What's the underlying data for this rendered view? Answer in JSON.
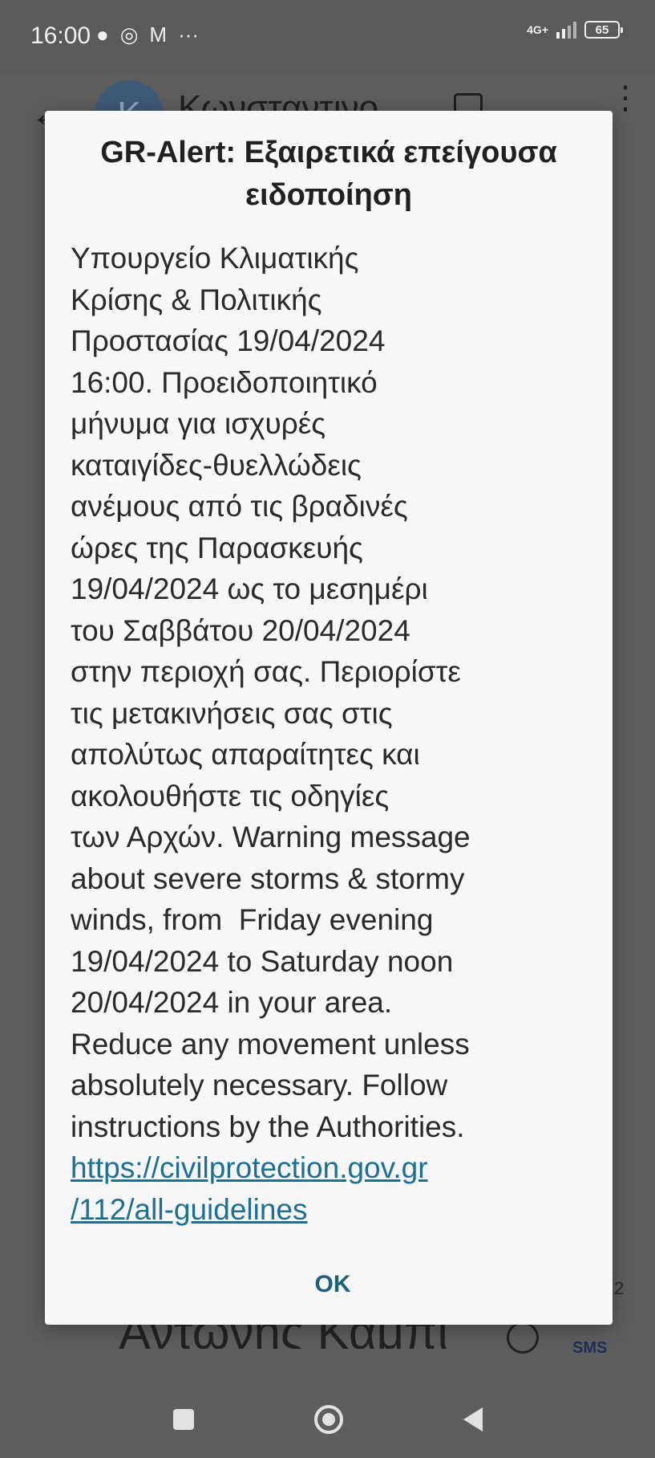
{
  "status_bar": {
    "time": "16:00",
    "notif_icons": [
      "chat-bubble-icon",
      "whatsapp-icon",
      "gmail-icon",
      "more-notifications-icon"
    ],
    "network": "4G+",
    "battery": "65"
  },
  "background": {
    "contact_avatar_letter": "K",
    "contact_name": "Κωνσταντινο",
    "composer_text": "Αντώνης Καμπι",
    "sms_label": "SMS",
    "message_count": "2"
  },
  "dialog": {
    "title": "GR-Alert: Εξαιρετικά επείγουσα ειδοποίηση",
    "body_lines": [
      "Υπουργείο Κλιματικής",
      "Κρίσης & Πολιτικής",
      "Προστασίας 19/04/2024",
      "16:00. Προειδοποιητικό",
      "μήνυμα για ισχυρές",
      "καταιγίδες-θυελλώδεις",
      "ανέμους από τις βραδινές",
      "ώρες της Παρασκευής",
      "19/04/2024 ως το μεσημέρι",
      "του Σαββάτου 20/04/2024",
      "στην περιοχή σας. Περιορίστε",
      "τις μετακινήσεις σας στις",
      "απολύτως απαραίτητες και",
      "ακολουθήστε τις οδηγίες",
      "των Αρχών. Warning message",
      "about severe storms & stormy",
      "winds, from  Friday evening",
      "19/04/2024 to Saturday noon",
      "20/04/2024 in your area.",
      "Reduce any movement unless",
      "absolutely necessary. Follow",
      "instructions by the Authorities."
    ],
    "link_lines": [
      "https://civilprotection.gov.gr",
      "/112/all-guidelines"
    ],
    "ok_label": "OK"
  }
}
